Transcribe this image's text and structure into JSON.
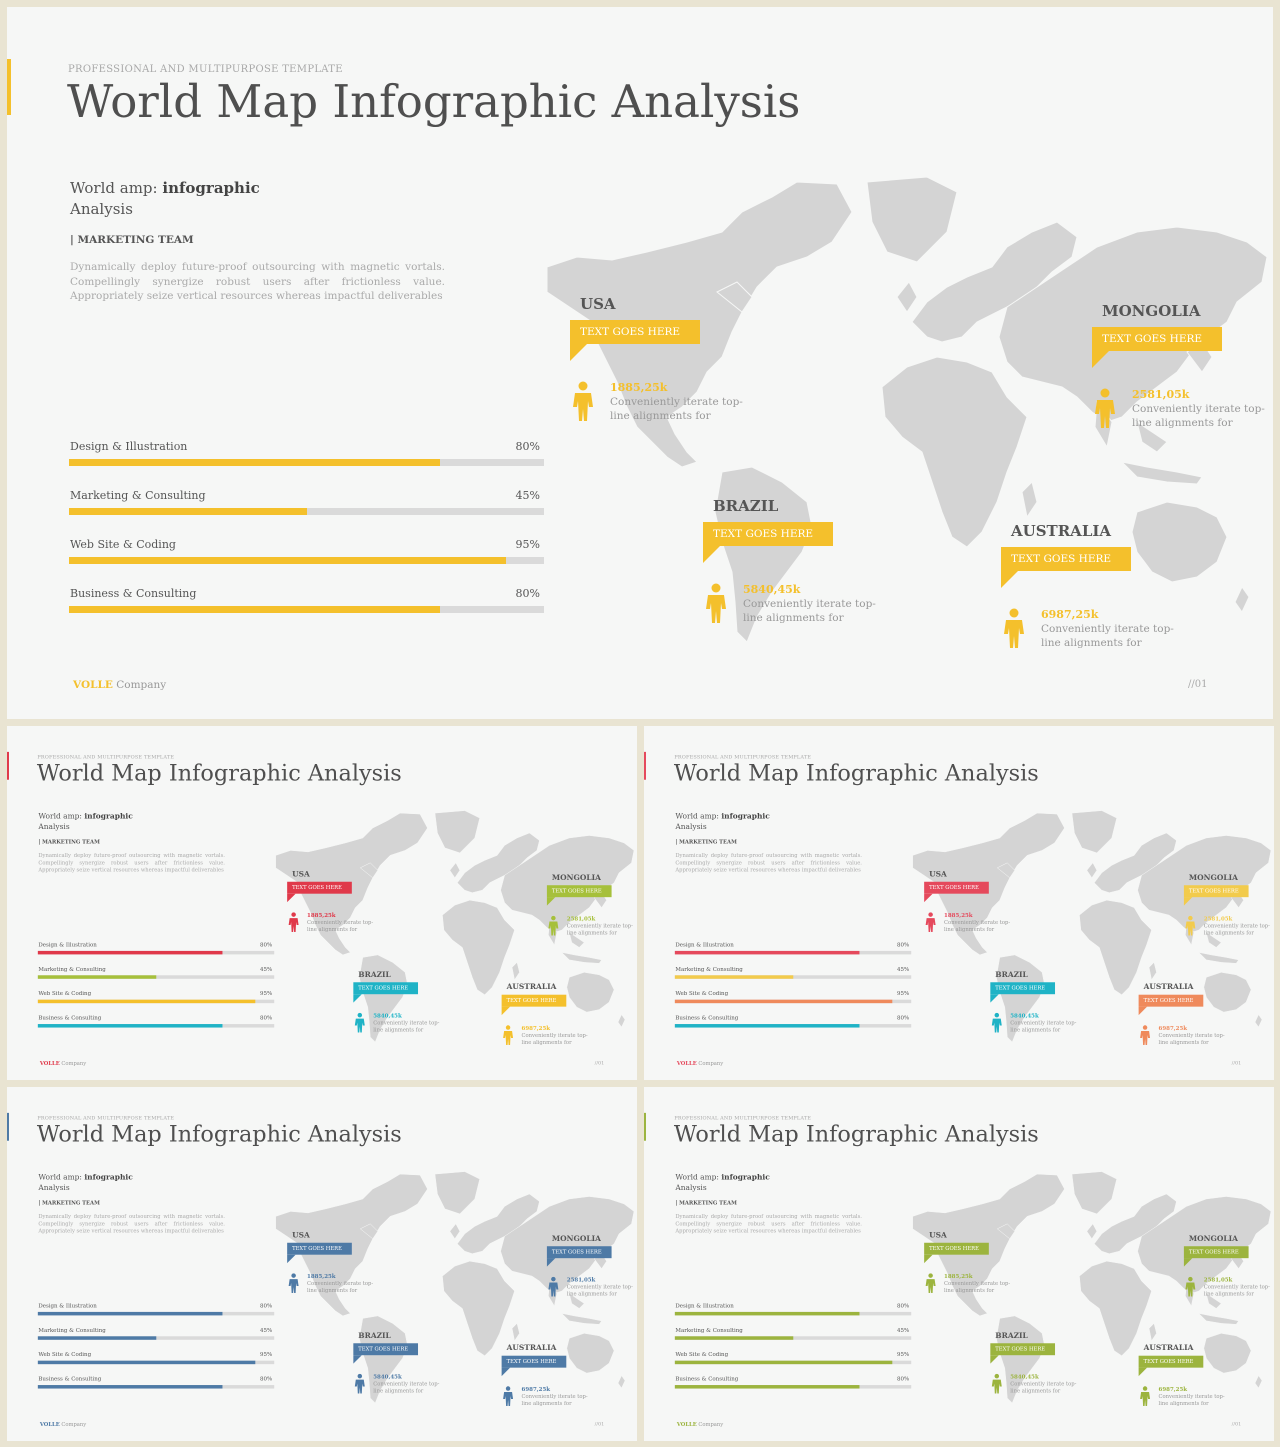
{
  "slides": [
    {
      "eyebrow": "PROFESSIONAL AND MULTIPURPOSE  TEMPLATE",
      "title": "World Map Infographic Analysis",
      "lead_prefix": "World amp:",
      "lead_bold": "infographic",
      "lead_suffix": "Analysis",
      "team": "| MARKETING TEAM",
      "description": "Dynamically deploy future-proof outsourcing with magnetic vortals. Compellingly synergize robust users after frictionless value. Appropriately seize vertical resources whereas impactful deliverables",
      "bars": [
        {
          "label": "Design & Illustration",
          "pct_text": "80%",
          "value": 0.78
        },
        {
          "label": "Marketing & Consulting",
          "pct_text": "45%",
          "value": 0.5
        },
        {
          "label": "Web Site & Coding",
          "pct_text": "95%",
          "value": 0.92
        },
        {
          "label": "Business  & Consulting",
          "pct_text": "80%",
          "value": 0.78
        }
      ],
      "callouts": [
        {
          "country": "USA",
          "tag": "TEXT GOES HERE",
          "number": "1885,25k",
          "desc": "Conveniently iterate top-line alignments for"
        },
        {
          "country": "MONGOLIA",
          "tag": "TEXT GOES HERE",
          "number": "2581,05k",
          "desc": "Conveniently iterate top-line alignments for"
        },
        {
          "country": "BRAZIL",
          "tag": "TEXT GOES HERE",
          "number": "5840,45k",
          "desc": "Conveniently iterate top-line alignments for"
        },
        {
          "country": "AUSTRALIA",
          "tag": "TEXT GOES HERE",
          "number": "6987,25k",
          "desc": "Conveniently iterate top-line alignments for"
        }
      ],
      "brand_bold": "VOLLE",
      "brand_rest": " Company",
      "page": "//01",
      "colors": {
        "accent": "#f4c02c",
        "bars": [
          "#f4c02c",
          "#f4c02c",
          "#f4c02c",
          "#f4c02c"
        ],
        "callouts": [
          "#f4c02c",
          "#f4c02c",
          "#f4c02c",
          "#f4c02c"
        ]
      }
    },
    {
      "eyebrow": "PROFESSIONAL AND MULTIPURPOSE  TEMPLATE",
      "title": "World Map Infographic Analysis",
      "lead_prefix": "World amp:",
      "lead_bold": "infographic",
      "lead_suffix": "Analysis",
      "team": "| MARKETING TEAM",
      "description": "Dynamically deploy future-proof outsourcing with magnetic vortals. Compellingly synergize robust users after frictionless value. Appropriately seize vertical resources whereas impactful deliverables",
      "bars": [
        {
          "label": "Design & Illustration",
          "pct_text": "80%",
          "value": 0.78
        },
        {
          "label": "Marketing & Consulting",
          "pct_text": "45%",
          "value": 0.5
        },
        {
          "label": "Web Site & Coding",
          "pct_text": "95%",
          "value": 0.92
        },
        {
          "label": "Business  & Consulting",
          "pct_text": "80%",
          "value": 0.78
        }
      ],
      "callouts": [
        {
          "country": "USA",
          "tag": "TEXT GOES HERE",
          "number": "1885,25k",
          "desc": "Conveniently iterate top-line alignments for"
        },
        {
          "country": "MONGOLIA",
          "tag": "TEXT GOES HERE",
          "number": "2581,05k",
          "desc": "Conveniently iterate top-line alignments for"
        },
        {
          "country": "BRAZIL",
          "tag": "TEXT GOES HERE",
          "number": "5840,45k",
          "desc": "Conveniently iterate top-line alignments for"
        },
        {
          "country": "AUSTRALIA",
          "tag": "TEXT GOES HERE",
          "number": "6987,25k",
          "desc": "Conveniently iterate top-line alignments for"
        }
      ],
      "brand_bold": "VOLLE",
      "brand_rest": " Company",
      "page": "//01",
      "colors": {
        "accent": "#e0394a",
        "bars": [
          "#e0394a",
          "#a6c03b",
          "#f4c02c",
          "#1fb3c6"
        ],
        "callouts": [
          "#e0394a",
          "#a6c03b",
          "#1fb3c6",
          "#f4c02c"
        ]
      }
    },
    {
      "eyebrow": "PROFESSIONAL AND MULTIPURPOSE  TEMPLATE",
      "title": "World Map Infographic Analysis",
      "lead_prefix": "World amp:",
      "lead_bold": "infographic",
      "lead_suffix": "Analysis",
      "team": "| MARKETING TEAM",
      "description": "Dynamically deploy future-proof outsourcing with magnetic vortals. Compellingly synergize robust users after frictionless value. Appropriately seize vertical resources whereas impactful deliverables",
      "bars": [
        {
          "label": "Design & Illustration",
          "pct_text": "80%",
          "value": 0.78
        },
        {
          "label": "Marketing & Consulting",
          "pct_text": "45%",
          "value": 0.5
        },
        {
          "label": "Web Site & Coding",
          "pct_text": "95%",
          "value": 0.92
        },
        {
          "label": "Business  & Consulting",
          "pct_text": "80%",
          "value": 0.78
        }
      ],
      "callouts": [
        {
          "country": "USA",
          "tag": "TEXT GOES HERE",
          "number": "1885,25k",
          "desc": "Conveniently iterate top-line alignments for"
        },
        {
          "country": "MONGOLIA",
          "tag": "TEXT GOES HERE",
          "number": "2581,05k",
          "desc": "Conveniently iterate top-line alignments for"
        },
        {
          "country": "BRAZIL",
          "tag": "TEXT GOES HERE",
          "number": "5840,45k",
          "desc": "Conveniently iterate top-line alignments for"
        },
        {
          "country": "AUSTRALIA",
          "tag": "TEXT GOES HERE",
          "number": "6987,25k",
          "desc": "Conveniently iterate top-line alignments for"
        }
      ],
      "brand_bold": "VOLLE",
      "brand_rest": " Company",
      "page": "//01",
      "colors": {
        "accent": "#e5495c",
        "bars": [
          "#e5495c",
          "#f2cb4c",
          "#ef8a5c",
          "#1fb3c6"
        ],
        "callouts": [
          "#e5495c",
          "#f2cb4c",
          "#1fb3c6",
          "#ef8a5c"
        ]
      }
    },
    {
      "eyebrow": "PROFESSIONAL AND MULTIPURPOSE  TEMPLATE",
      "title": "World Map Infographic Analysis",
      "lead_prefix": "World amp:",
      "lead_bold": "infographic",
      "lead_suffix": "Analysis",
      "team": "| MARKETING TEAM",
      "description": "Dynamically deploy future-proof outsourcing with magnetic vortals. Compellingly synergize robust users after frictionless value. Appropriately seize vertical resources whereas impactful deliverables",
      "bars": [
        {
          "label": "Design & Illustration",
          "pct_text": "80%",
          "value": 0.78
        },
        {
          "label": "Marketing & Consulting",
          "pct_text": "45%",
          "value": 0.5
        },
        {
          "label": "Web Site & Coding",
          "pct_text": "95%",
          "value": 0.92
        },
        {
          "label": "Business  & Consulting",
          "pct_text": "80%",
          "value": 0.78
        }
      ],
      "callouts": [
        {
          "country": "USA",
          "tag": "TEXT GOES HERE",
          "number": "1885,25k",
          "desc": "Conveniently iterate top-line alignments for"
        },
        {
          "country": "MONGOLIA",
          "tag": "TEXT GOES HERE",
          "number": "2581,05k",
          "desc": "Conveniently iterate top-line alignments for"
        },
        {
          "country": "BRAZIL",
          "tag": "TEXT GOES HERE",
          "number": "5840,45k",
          "desc": "Conveniently iterate top-line alignments for"
        },
        {
          "country": "AUSTRALIA",
          "tag": "TEXT GOES HERE",
          "number": "6987,25k",
          "desc": "Conveniently iterate top-line alignments for"
        }
      ],
      "brand_bold": "VOLLE",
      "brand_rest": " Company",
      "page": "//01",
      "colors": {
        "accent": "#4e7aa6",
        "bars": [
          "#4e7aa6",
          "#4e7aa6",
          "#4e7aa6",
          "#4e7aa6"
        ],
        "callouts": [
          "#4e7aa6",
          "#4e7aa6",
          "#4e7aa6",
          "#4e7aa6"
        ]
      }
    },
    {
      "eyebrow": "PROFESSIONAL AND MULTIPURPOSE  TEMPLATE",
      "title": "World Map Infographic Analysis",
      "lead_prefix": "World amp:",
      "lead_bold": "infographic",
      "lead_suffix": "Analysis",
      "team": "| MARKETING TEAM",
      "description": "Dynamically deploy future-proof outsourcing with magnetic vortals. Compellingly synergize robust users after frictionless value. Appropriately seize vertical resources whereas impactful deliverables",
      "bars": [
        {
          "label": "Design & Illustration",
          "pct_text": "80%",
          "value": 0.78
        },
        {
          "label": "Marketing & Consulting",
          "pct_text": "45%",
          "value": 0.5
        },
        {
          "label": "Web Site & Coding",
          "pct_text": "95%",
          "value": 0.92
        },
        {
          "label": "Business  & Consulting",
          "pct_text": "80%",
          "value": 0.78
        }
      ],
      "callouts": [
        {
          "country": "USA",
          "tag": "TEXT GOES HERE",
          "number": "1885,25k",
          "desc": "Conveniently iterate top-line alignments for"
        },
        {
          "country": "MONGOLIA",
          "tag": "TEXT GOES HERE",
          "number": "2581,05k",
          "desc": "Conveniently iterate top-line alignments for"
        },
        {
          "country": "BRAZIL",
          "tag": "TEXT GOES HERE",
          "number": "5840,45k",
          "desc": "Conveniently iterate top-line alignments for"
        },
        {
          "country": "AUSTRALIA",
          "tag": "TEXT GOES HERE",
          "number": "6987,25k",
          "desc": "Conveniently iterate top-line alignments for"
        }
      ],
      "brand_bold": "VOLLE",
      "brand_rest": " Company",
      "page": "//01",
      "colors": {
        "accent": "#9cb43e",
        "bars": [
          "#9cb43e",
          "#9cb43e",
          "#9cb43e",
          "#9cb43e"
        ],
        "callouts": [
          "#9cb43e",
          "#9cb43e",
          "#9cb43e",
          "#9cb43e"
        ]
      }
    }
  ]
}
